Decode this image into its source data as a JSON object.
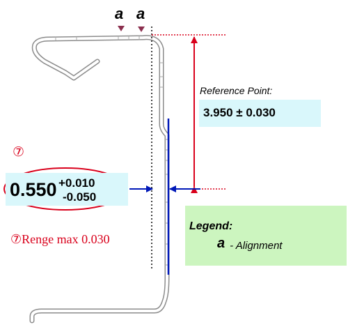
{
  "markers": {
    "left": "a",
    "right": "a"
  },
  "reference": {
    "label": "Reference Point:",
    "value": "3.950 ± 0.030"
  },
  "feature": {
    "number": "⑦",
    "nominal": "0.550",
    "upper_tol": "+0.010",
    "lower_tol": "-0.050",
    "range_note": "⑦Renge max 0.030"
  },
  "legend": {
    "title": "Legend:",
    "symbol": "a",
    "description": " - Alignment"
  },
  "colors": {
    "red": "#d9001b",
    "blue": "#0018b8",
    "marker": "#8b2f4e",
    "value_bg": "#d9f7fb",
    "legend_bg": "#ccf5bf"
  }
}
